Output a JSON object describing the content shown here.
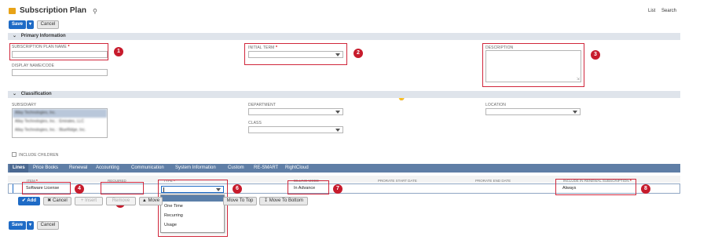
{
  "header": {
    "title": "Subscription Plan",
    "links": [
      "List",
      "Search"
    ]
  },
  "toolbar": {
    "save_label": "Save",
    "cancel_label": "Cancel"
  },
  "primary": {
    "section_label": "Primary Information",
    "plan_name_label": "SUBSCRIPTION PLAN NAME",
    "display_name_label": "DISPLAY NAME/CODE",
    "initial_term_label": "INITIAL TERM",
    "description_label": "DESCRIPTION"
  },
  "classification": {
    "section_label": "Classification",
    "subsidiary_label": "SUBSIDIARY",
    "subsidiary_options": [
      "Allay Technologies, Inc.",
      "Allay Technologies, Inc. : Emirates, LLC",
      "Allay Technologies, Inc. : BlueRidge, Inc."
    ],
    "include_children_label": "INCLUDE CHILDREN",
    "department_label": "DEPARTMENT",
    "class_label": "CLASS",
    "location_label": "LOCATION"
  },
  "tabs": [
    "Lines",
    "Price Books",
    "Renewal",
    "Accounting",
    "Communication",
    "System Information",
    "Custom",
    "RE-SMART",
    "RightCloud"
  ],
  "lines": {
    "columns": [
      "ITEM",
      "REQUIRED",
      "TYPE",
      "BILLING MODE",
      "PRORATE START DATE",
      "PRORATE END DATE",
      "INCLUDE IN RENEWAL SUBSCRIPTION"
    ],
    "row": {
      "item": "Software License",
      "billing_mode": "In Advance",
      "renewal": "Always"
    },
    "buttons": {
      "add": "Add",
      "cancel": "Cancel",
      "insert": "Insert",
      "remove": "Remove",
      "move": "Move",
      "move_top": "Move To Top",
      "move_bottom": "Move To Bottom"
    },
    "type_options": [
      "One Time",
      "Recurring",
      "Usage"
    ]
  },
  "callouts": [
    "1",
    "2",
    "3",
    "4",
    "5",
    "6",
    "7",
    "8"
  ],
  "colors": {
    "primary_blue": "#1e6bc6",
    "tabbar": "#5f7ea6",
    "callout_red": "#c71b2c",
    "section_bar": "#dfe4eb"
  }
}
